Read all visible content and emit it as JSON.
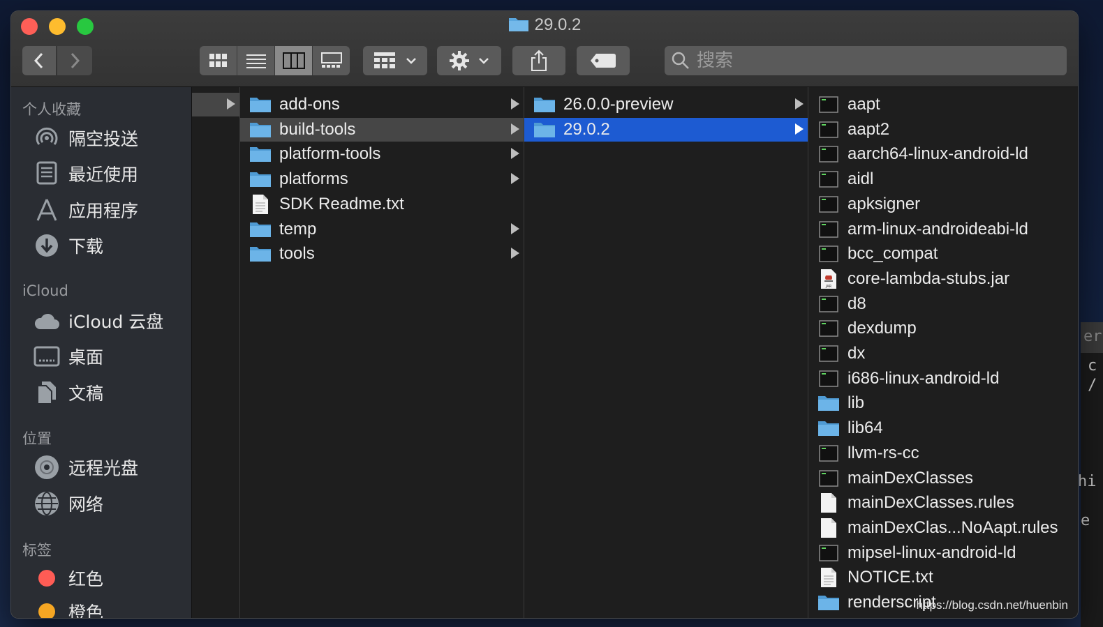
{
  "window": {
    "title": "29.0.2"
  },
  "toolbar": {
    "back_icon": "chevron-left-icon",
    "forward_icon": "chevron-right-icon",
    "view_modes": [
      "icon-view",
      "list-view",
      "column-view",
      "gallery-view"
    ],
    "active_view": "column-view",
    "search_placeholder": "搜索"
  },
  "sidebar": {
    "sections": [
      {
        "title": "个人收藏",
        "items": [
          {
            "label": "隔空投送",
            "icon": "airdrop-icon"
          },
          {
            "label": "最近使用",
            "icon": "recents-icon"
          },
          {
            "label": "应用程序",
            "icon": "applications-icon"
          },
          {
            "label": "下载",
            "icon": "downloads-icon"
          }
        ]
      },
      {
        "title": "iCloud",
        "items": [
          {
            "label": "iCloud 云盘",
            "icon": "cloud-icon"
          },
          {
            "label": "桌面",
            "icon": "desktop-icon"
          },
          {
            "label": "文稿",
            "icon": "documents-icon"
          }
        ]
      },
      {
        "title": "位置",
        "items": [
          {
            "label": "远程光盘",
            "icon": "disc-icon"
          },
          {
            "label": "网络",
            "icon": "network-icon"
          }
        ]
      },
      {
        "title": "标签",
        "items": [
          {
            "label": "红色",
            "icon": "tag-red-icon",
            "color": "#fe5c55"
          },
          {
            "label": "橙色",
            "icon": "tag-orange-icon",
            "color": "#f5a623"
          }
        ]
      }
    ]
  },
  "columns": {
    "col2": [
      {
        "name": "add-ons",
        "type": "folder",
        "has_children": true
      },
      {
        "name": "build-tools",
        "type": "folder",
        "has_children": true,
        "selected": "gray"
      },
      {
        "name": "platform-tools",
        "type": "folder",
        "has_children": true
      },
      {
        "name": "platforms",
        "type": "folder",
        "has_children": true
      },
      {
        "name": "SDK Readme.txt",
        "type": "text",
        "has_children": false
      },
      {
        "name": "temp",
        "type": "folder",
        "has_children": true
      },
      {
        "name": "tools",
        "type": "folder",
        "has_children": true
      }
    ],
    "col3": [
      {
        "name": "26.0.0-preview",
        "type": "folder",
        "has_children": true
      },
      {
        "name": "29.0.2",
        "type": "folder",
        "has_children": true,
        "selected": "blue"
      }
    ],
    "col4": [
      {
        "name": "aapt",
        "type": "exec"
      },
      {
        "name": "aapt2",
        "type": "exec"
      },
      {
        "name": "aarch64-linux-android-ld",
        "type": "exec"
      },
      {
        "name": "aidl",
        "type": "exec"
      },
      {
        "name": "apksigner",
        "type": "exec"
      },
      {
        "name": "arm-linux-androideabi-ld",
        "type": "exec"
      },
      {
        "name": "bcc_compat",
        "type": "exec"
      },
      {
        "name": "core-lambda-stubs.jar",
        "type": "jar"
      },
      {
        "name": "d8",
        "type": "exec"
      },
      {
        "name": "dexdump",
        "type": "exec"
      },
      {
        "name": "dx",
        "type": "exec"
      },
      {
        "name": "i686-linux-android-ld",
        "type": "exec"
      },
      {
        "name": "lib",
        "type": "folder"
      },
      {
        "name": "lib64",
        "type": "folder"
      },
      {
        "name": "llvm-rs-cc",
        "type": "exec"
      },
      {
        "name": "mainDexClasses",
        "type": "exec"
      },
      {
        "name": "mainDexClasses.rules",
        "type": "blank"
      },
      {
        "name": "mainDexClas...NoAapt.rules",
        "type": "blank"
      },
      {
        "name": "mipsel-linux-android-ld",
        "type": "exec"
      },
      {
        "name": "NOTICE.txt",
        "type": "text"
      },
      {
        "name": "renderscript",
        "type": "folder"
      }
    ]
  },
  "backdrop": {
    "lines": [
      "er",
      "c",
      "/",
      "hi",
      "e"
    ]
  },
  "watermark": "https://blog.csdn.net/huenbin"
}
